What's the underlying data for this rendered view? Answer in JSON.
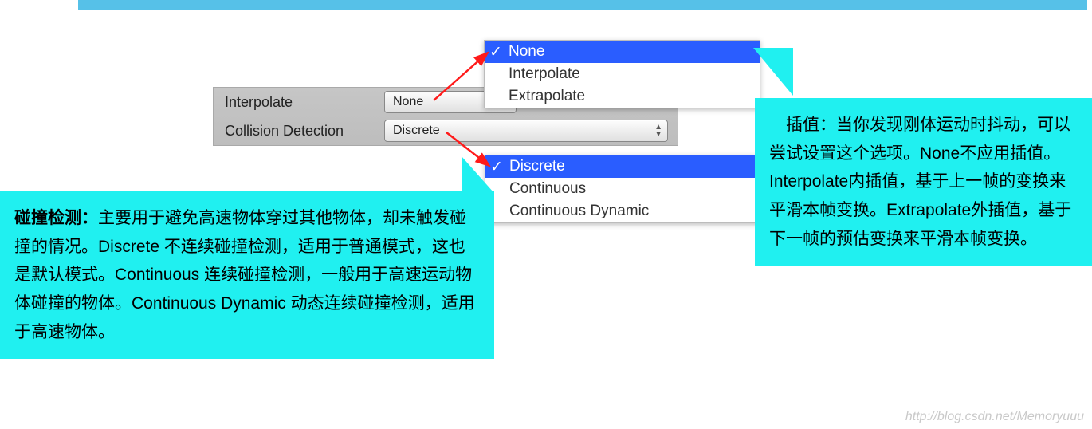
{
  "inspector": {
    "interpolate_label": "Interpolate",
    "interpolate_value": "None",
    "collision_label": "Collision Detection",
    "collision_value": "Discrete"
  },
  "interpolate_menu": {
    "selected": "None",
    "opt1": "Interpolate",
    "opt2": "Extrapolate"
  },
  "collision_menu": {
    "selected": "Discrete",
    "opt1": "Continuous",
    "opt2": "Continuous Dynamic"
  },
  "callout_left": {
    "title": "碰撞检测：",
    "body": "主要用于避免高速物体穿过其他物体，却未触发碰撞的情况。Discrete 不连续碰撞检测，适用于普通模式，这也是默认模式。Continuous 连续碰撞检测，一般用于高速运动物体碰撞的物体。Continuous Dynamic 动态连续碰撞检测，适用于高速物体。"
  },
  "callout_right": {
    "body": "　插值：当你发现刚体运动时抖动，可以尝试设置这个选项。None不应用插值。Interpolate内插值，基于上一帧的变换来平滑本帧变换。Extrapolate外插值，基于下一帧的预估变换来平滑本帧变换。"
  },
  "watermark": "http://blog.csdn.net/Memoryuuu",
  "check": "✓",
  "caret_up": "▲",
  "caret_dn": "▼"
}
